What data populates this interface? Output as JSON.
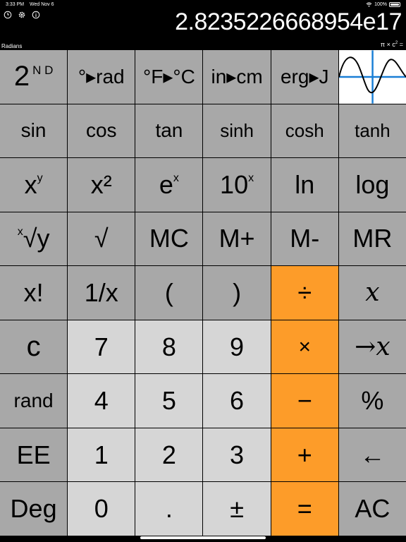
{
  "status_bar": {
    "time": "3:33 PM",
    "date": "Wed Nov 6",
    "battery": "100%"
  },
  "toolbar": {
    "icons": [
      "history-icon",
      "gear-icon",
      "info-icon"
    ]
  },
  "display": {
    "value": "2.8235226668954e17",
    "mode": "Radians",
    "formula_prefix": "π × c",
    "formula_exp": "2",
    "formula_suffix": " ="
  },
  "colors": {
    "dark_key": "#a8a8a8",
    "light_key": "#d6d6d6",
    "operator_key": "#fd9c29",
    "graph_line": "#1a7fd6"
  },
  "keys": {
    "second": {
      "base": "2",
      "sup": "N D"
    },
    "deg_rad": "°▸rad",
    "f_c": "°F▸°C",
    "in_cm": "in▸cm",
    "erg_j": "erg▸J",
    "sin": "sin",
    "cos": "cos",
    "tan": "tan",
    "sinh": "sinh",
    "cosh": "cosh",
    "tanh": "tanh",
    "xy": {
      "base": "x",
      "sup": "y"
    },
    "x2": "x²",
    "ex": {
      "base": "e",
      "sup": "x"
    },
    "tenx": {
      "base": "10",
      "sup": "x"
    },
    "ln": "ln",
    "log": "log",
    "xrooty": {
      "pre": "x",
      "base": "√y"
    },
    "sqrt": "√",
    "mc": "MC",
    "mplus": "M+",
    "mminus": "M-",
    "mr": "MR",
    "fact": "x!",
    "recip": "1/x",
    "lparen": "(",
    "rparen": ")",
    "divide": "÷",
    "var_x": "x",
    "clear": "c",
    "seven": "7",
    "eight": "8",
    "nine": "9",
    "multiply": "×",
    "assign_x": "→x",
    "rand": "rand",
    "four": "4",
    "five": "5",
    "six": "6",
    "minus": "−",
    "percent": "%",
    "ee": "EE",
    "one": "1",
    "two": "2",
    "three": "3",
    "plus": "+",
    "backspace": "←",
    "deg": "Deg",
    "zero": "0",
    "dot": ".",
    "plusminus": "±",
    "equals": "=",
    "ac": "AC"
  }
}
